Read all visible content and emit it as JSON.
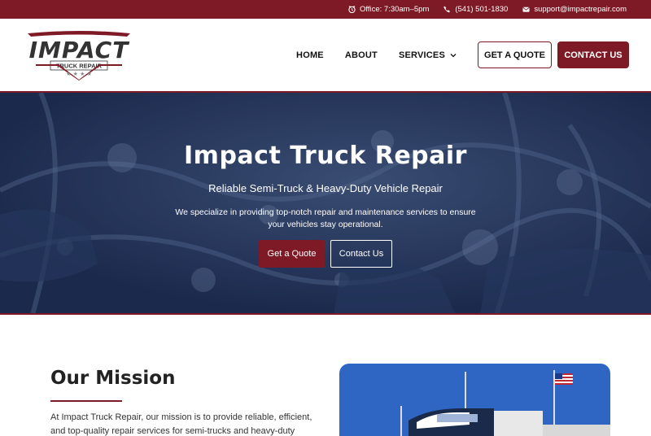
{
  "topbar": {
    "office": "Office: 7:30am–5pm",
    "phone": "(541) 501-1830",
    "email": "support@impactrepair.com"
  },
  "logo": {
    "name": "IMPACT",
    "tagline": "TRUCK REPAIR"
  },
  "nav": {
    "home": "HOME",
    "about": "ABOUT",
    "services": "SERVICES",
    "quote_button": "GET A QUOTE",
    "contact_button": "CONTACT US"
  },
  "hero": {
    "title": "Impact Truck Repair",
    "subtitle": "Reliable Semi-Truck & Heavy-Duty Vehicle Repair",
    "text": "We specialize in providing top-notch repair and maintenance services to ensure your vehicles stay operational.",
    "quote_button": "Get a Quote",
    "contact_button": "Contact Us"
  },
  "mission": {
    "title": "Our Mission",
    "text": "At Impact Truck Repair, our mission is to provide reliable, efficient, and top-quality repair services for semi-trucks and heavy-duty"
  },
  "colors": {
    "brand": "#7e1a25",
    "hero_overlay": "#1e2f55"
  },
  "icons": {
    "clock": "clock-icon",
    "phone": "phone-icon",
    "email": "email-icon",
    "chevron": "chevron-down-icon"
  }
}
